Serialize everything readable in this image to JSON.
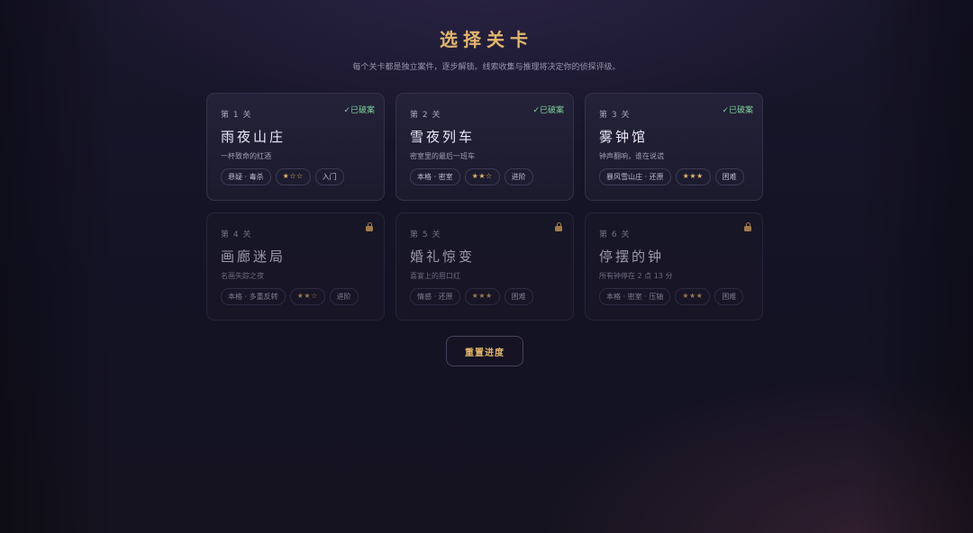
{
  "page": {
    "title": "选择关卡",
    "subtitle": "每个关卡都是独立案件，逐步解锁。线索收集与推理将决定你的侦探评级。",
    "reset_label": "重置进度"
  },
  "colors": {
    "accent": "#e2b66e",
    "solved": "#7fd19a",
    "lock": "#a07a4c"
  },
  "levels": [
    {
      "stage": "第 1 关",
      "name": "雨夜山庄",
      "desc": "一杯致命的红酒",
      "tags": [
        "悬疑 · 毒杀",
        "★☆☆",
        "入门"
      ],
      "status": "已破案",
      "status_icon": "check-icon"
    },
    {
      "stage": "第 2 关",
      "name": "雪夜列车",
      "desc": "密室里的最后一班车",
      "tags": [
        "本格 · 密室",
        "★★☆",
        "进阶"
      ],
      "status": "已破案",
      "status_icon": "check-icon"
    },
    {
      "stage": "第 3 关",
      "name": "雾钟馆",
      "desc": "钟声翻响，谁在说谎",
      "tags": [
        "暴风雪山庄 · 还原",
        "★★★",
        "困难"
      ],
      "status": "已破案",
      "status_icon": "check-icon"
    },
    {
      "stage": "第 4 关",
      "name": "画廊迷局",
      "desc": "名画失踪之夜",
      "tags": [
        "本格 · 多重反转",
        "★★☆",
        "进阶"
      ],
      "status_icon": "lock-icon"
    },
    {
      "stage": "第 5 关",
      "name": "婚礼惊变",
      "desc": "喜宴上的唇口红",
      "tags": [
        "情感 · 还原",
        "★★★",
        "困难"
      ],
      "status_icon": "lock-icon"
    },
    {
      "stage": "第 6 关",
      "name": "停摆的钟",
      "desc": "所有钟停在 2 点 13 分",
      "tags": [
        "本格 · 密室 · 压轴",
        "★★★",
        "困难"
      ],
      "status_icon": "lock-icon"
    }
  ]
}
